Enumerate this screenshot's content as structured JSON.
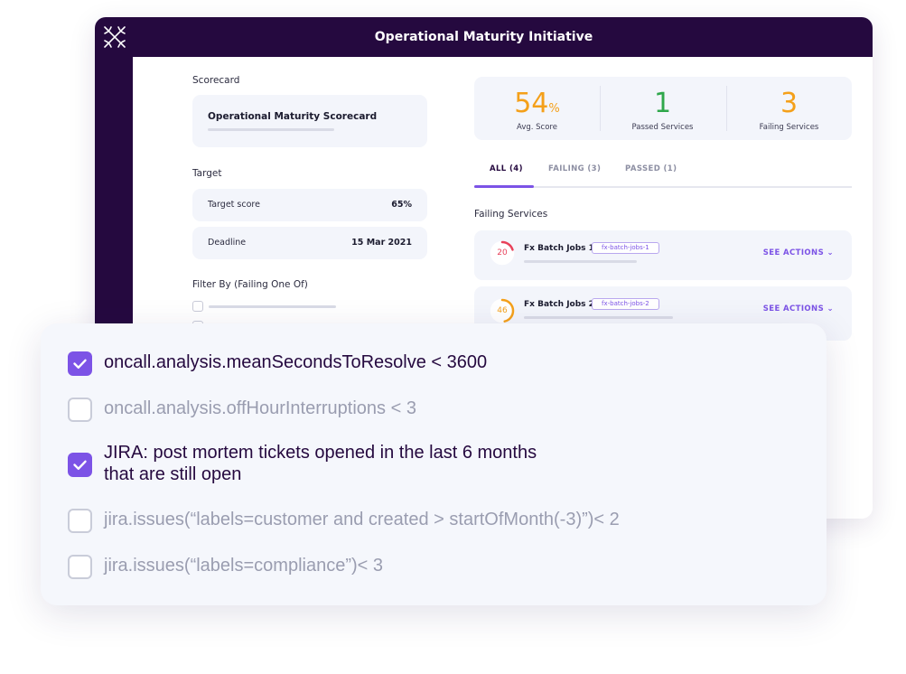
{
  "app": {
    "title": "Operational Maturity Initiative",
    "colors": {
      "header": "#25093f",
      "accent": "#7c53e6",
      "success": "#2fa74b",
      "warning": "#f4a01a",
      "danger": "#e8415a"
    }
  },
  "left": {
    "scorecard_label": "Scorecard",
    "scorecard_name": "Operational Maturity Scorecard",
    "target_label": "Target",
    "target_score_label": "Target score",
    "target_score_value": "65%",
    "deadline_label": "Deadline",
    "deadline_value": "15 Mar 2021",
    "filter_label": "Filter By (Failing One Of)"
  },
  "stats": [
    {
      "value": "54",
      "unit": "%",
      "caption": "Avg. Score",
      "color": "#f4a01a"
    },
    {
      "value": "1",
      "unit": "",
      "caption": "Passed Services",
      "color": "#2fa74b"
    },
    {
      "value": "3",
      "unit": "",
      "caption": "Failing Services",
      "color": "#f4a01a"
    }
  ],
  "tabs": [
    {
      "label": "ALL (4)",
      "active": true
    },
    {
      "label": "FAILING (3)",
      "active": false
    },
    {
      "label": "PASSED (1)",
      "active": false
    }
  ],
  "failing_label": "Failing Services",
  "services": [
    {
      "score": "20",
      "score_fraction": 0.2,
      "color": "#e8415a",
      "name": "Fx Batch Jobs 1",
      "tag": "fx-batch-jobs-1",
      "action": "SEE ACTIONS"
    },
    {
      "score": "46",
      "score_fraction": 0.46,
      "color": "#f4a01a",
      "name": "Fx Batch Jobs 2",
      "tag": "fx-batch-jobs-2",
      "action": "SEE ACTIONS"
    }
  ],
  "checklist": [
    {
      "checked": true,
      "lines": [
        "oncall.analysis.meanSecondsToResolve < 3600"
      ]
    },
    {
      "checked": false,
      "lines": [
        "oncall.analysis.offHourInterruptions < 3"
      ]
    },
    {
      "checked": true,
      "lines": [
        "JIRA: post mortem tickets opened in the last 6 months",
        "that are still open"
      ]
    },
    {
      "checked": false,
      "lines": [
        "jira.issues(“labels=customer and created > startOfMonth(-3)”)< 2"
      ]
    },
    {
      "checked": false,
      "lines": [
        "jira.issues(“labels=compliance”)< 3"
      ]
    }
  ]
}
